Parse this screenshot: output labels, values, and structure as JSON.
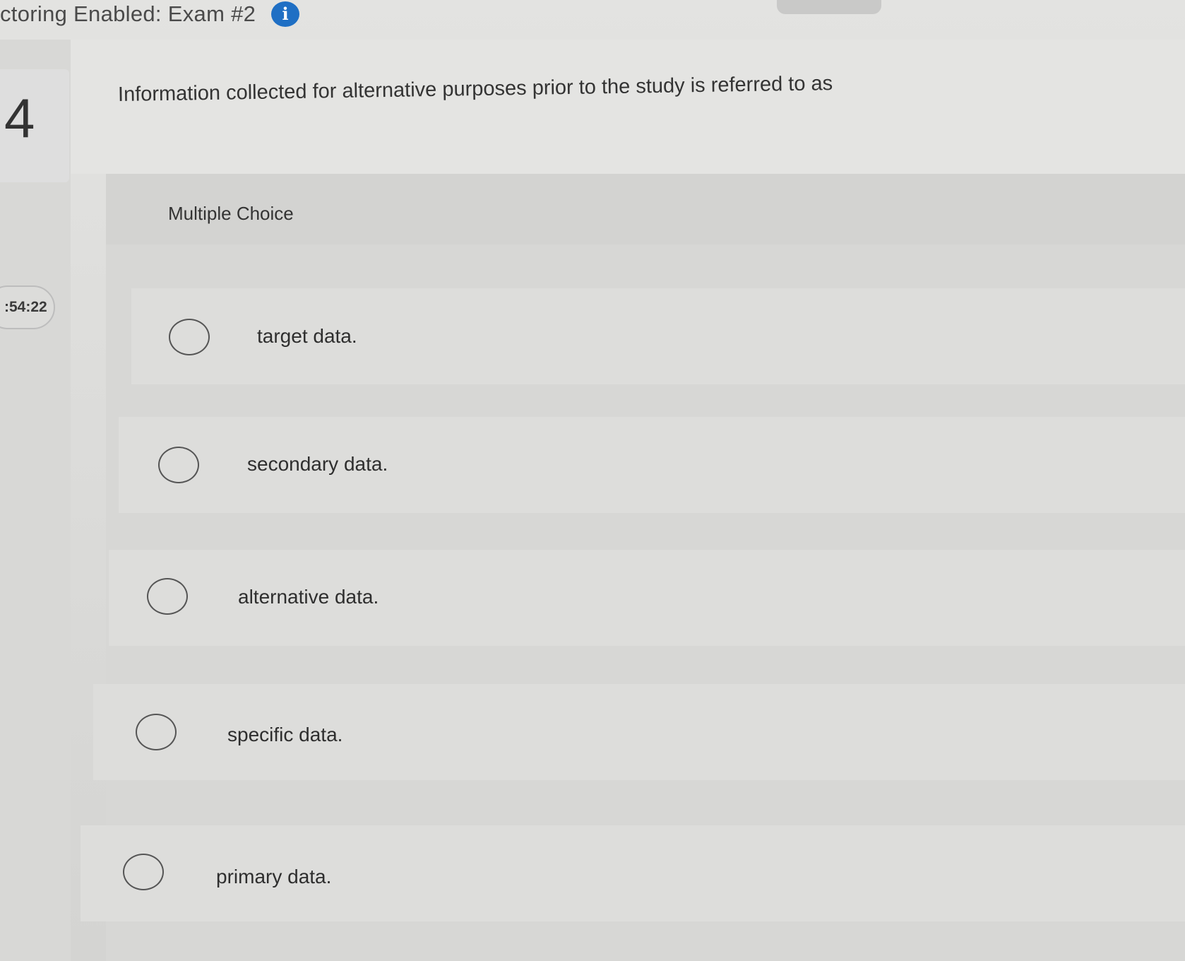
{
  "header": {
    "exam_title": "ctoring Enabled: Exam #2",
    "info_icon": "i"
  },
  "question": {
    "number": "4",
    "timer": ":54:22",
    "text": "Information collected for alternative purposes prior to the study is referred to as",
    "type_label": "Multiple Choice"
  },
  "options": [
    {
      "label": "target data.",
      "selected": false
    },
    {
      "label": "secondary data.",
      "selected": false
    },
    {
      "label": "alternative data.",
      "selected": false
    },
    {
      "label": "specific data.",
      "selected": false
    },
    {
      "label": "primary data.",
      "selected": false
    }
  ],
  "colors": {
    "accent": "#1f6fc4",
    "background": "#d6d6d4",
    "text": "#2f2f2f"
  }
}
